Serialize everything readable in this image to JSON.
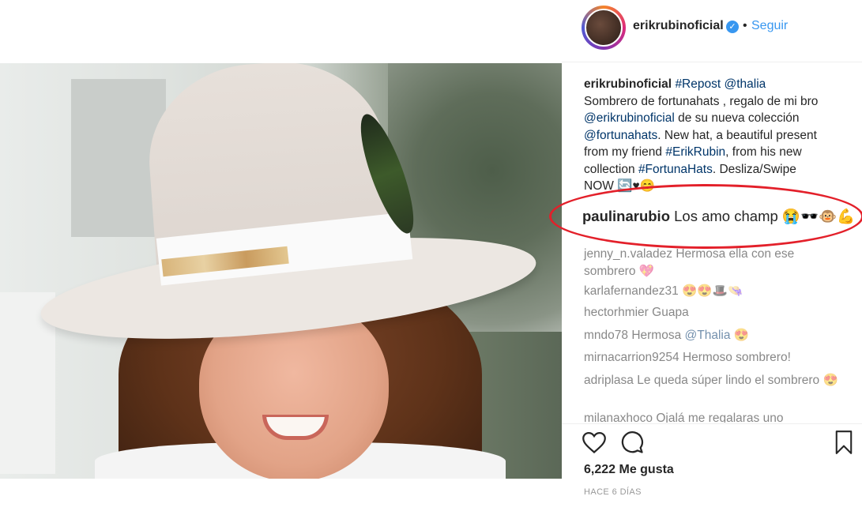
{
  "post": {
    "username": "erikrubinoficial",
    "follow_label": "Seguir",
    "dot": "•",
    "caption": {
      "username": "erikrubinoficial",
      "parts": [
        {
          "t": "#Repost",
          "link": true
        },
        {
          "t": " ",
          "link": false
        },
        {
          "t": "@thalia",
          "link": true
        },
        {
          "t": " Sombrero de fortunahats , regalo de mi bro ",
          "link": false
        },
        {
          "t": "@erikrubinoficial",
          "link": true
        },
        {
          "t": " de su nueva colección ",
          "link": false
        },
        {
          "t": "@fortunahats",
          "link": true
        },
        {
          "t": ". New hat, a beautiful present from my friend ",
          "link": false
        },
        {
          "t": "#ErikRubin",
          "link": true
        },
        {
          "t": ", from his new collection ",
          "link": false
        },
        {
          "t": "#FortunaHats",
          "link": true
        },
        {
          "t": ". Desliza/Swipe NOW 🔄♥😊",
          "link": false
        }
      ]
    },
    "highlight_comment": {
      "username": "paulinarubio",
      "text": "Los amo champ 😭🕶️🐵💪"
    },
    "comments": [
      {
        "username": "jenny_n.valadez",
        "text": "Hermosa ella con ese sombrero 💖"
      },
      {
        "username": "karlafernandez31",
        "text": "😍😍🎩👒"
      },
      {
        "username": "hectorhmier",
        "text": "Guapa"
      },
      {
        "username": "mndo78",
        "text": "Hermosa ",
        "mention": "@Thalia",
        "tail": " 😍"
      },
      {
        "username": "mirnacarrion9254",
        "text": "Hermoso sombrero!"
      },
      {
        "username": "adriplasa",
        "text": "Le queda súper lindo el sombrero 😍"
      },
      {
        "username": "milanaxhoco",
        "text": "Ojalá me regalaras uno"
      }
    ],
    "likes": "6,222 Me gusta",
    "time": "HACE 6 DÍAS"
  },
  "icons": {
    "verified": "verified-badge-icon",
    "like": "heart-icon",
    "comment": "comment-bubble-icon",
    "save": "bookmark-icon"
  },
  "colors": {
    "link": "#003569",
    "follow": "#3897f0",
    "annotation": "#e3202a"
  }
}
